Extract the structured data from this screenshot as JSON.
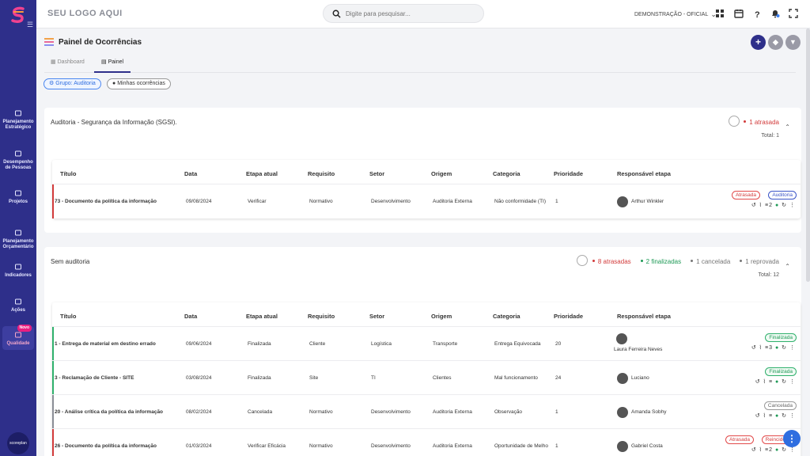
{
  "sidebar": {
    "items": [
      {
        "label": "Planejamento Estratégico",
        "icon": "house-icon"
      },
      {
        "label": "Desempenho de Pessoas",
        "icon": "handshake-icon"
      },
      {
        "label": "Projetos",
        "icon": "briefcase-icon"
      },
      {
        "label": "Planejamento Orçamentário",
        "icon": "bank-icon"
      },
      {
        "label": "Indicadores",
        "icon": "bar-chart-icon"
      },
      {
        "label": "Ações",
        "icon": "list-icon"
      },
      {
        "label": "Qualidade",
        "icon": "trend-icon",
        "badge": "Novo",
        "active": true
      }
    ],
    "bottom_label": "scoreplan"
  },
  "topbar": {
    "logo": "SEU LOGO AQUI",
    "search_placeholder": "Digite para pesquisar...",
    "environment": "DEMONSTRAÇÃO - OFICIAL"
  },
  "page": {
    "title": "Painel de Ocorrências",
    "tabs": [
      {
        "label": "Dashboard"
      },
      {
        "label": "Painel",
        "active": true
      }
    ],
    "chips": {
      "group": "Grupo: Auditoria",
      "mine": "Minhas ocorrências"
    }
  },
  "columns": [
    "Título",
    "Data",
    "Etapa atual",
    "Requisito",
    "Setor",
    "Origem",
    "Categoria",
    "Prioridade",
    "Responsável etapa"
  ],
  "groups": [
    {
      "title": "Auditoria - Segurança da Informação (SGSI).",
      "stats": [
        {
          "label": "1 atrasada",
          "color": "#d23b3b"
        }
      ],
      "total": "Total: 1",
      "rows": [
        {
          "titulo": "73 - Documento da política da informação",
          "data": "09/08/2024",
          "etapa": "Verificar",
          "requisito": "Normativo",
          "setor": "Desenvolvimento",
          "origem": "Auditoria Externa",
          "categoria": "Não conformidade (TI)",
          "prioridade": "1",
          "responsavel": "Arthur Winkler",
          "bar": "#d23b3b",
          "tags": [
            {
              "label": "Atrasada",
              "style": "red"
            },
            {
              "label": "Auditoria",
              "style": "blue"
            }
          ],
          "acts": "2"
        }
      ]
    },
    {
      "title": "Sem auditoria",
      "stats": [
        {
          "label": "8 atrasadas",
          "color": "#d23b3b"
        },
        {
          "label": "2 finalizadas",
          "color": "#1f9a57"
        },
        {
          "label": "1 cancelada",
          "color": "#777777"
        },
        {
          "label": "1 reprovada",
          "color": "#777777"
        }
      ],
      "total": "Total: 12",
      "rows": [
        {
          "titulo": "1 - Entrega de material em destino errado",
          "data": "09/06/2024",
          "etapa": "Finalizada",
          "requisito": "Cliente",
          "setor": "Logística",
          "origem": "Transporte",
          "categoria": "Entrega Equivocada",
          "prioridade": "20",
          "responsavel": "Laura Ferreira Neves",
          "bar": "#2fb06c",
          "tags": [
            {
              "label": "Finalizada",
              "style": "green"
            }
          ],
          "acts": "3"
        },
        {
          "titulo": "3 - Reclamação de Cliente - SITE",
          "data": "03/08/2024",
          "etapa": "Finalizada",
          "requisito": "Site",
          "setor": "TI",
          "origem": "Clientes",
          "categoria": "Mal funcionamento",
          "prioridade": "24",
          "responsavel": "Luciano",
          "bar": "#2fb06c",
          "tags": [
            {
              "label": "Finalizada",
              "style": "green"
            }
          ],
          "acts": ""
        },
        {
          "titulo": "20 - Análise crítica da política da informação",
          "data": "08/02/2024",
          "etapa": "Cancelada",
          "requisito": "Normativo",
          "setor": "Desenvolvimento",
          "origem": "Auditoria Externa",
          "categoria": "Observação",
          "prioridade": "1",
          "responsavel": "Amanda Sobhy",
          "bar": "#8a8d96",
          "tags": [
            {
              "label": "Cancelada",
              "style": "gray"
            }
          ],
          "acts": ""
        },
        {
          "titulo": "26 - Documento da política da informação",
          "data": "01/03/2024",
          "etapa": "Verificar Eficácia",
          "requisito": "Normativo",
          "setor": "Desenvolvimento",
          "origem": "Auditoria Externa",
          "categoria": "Oportunidade de Melho",
          "prioridade": "1",
          "responsavel": "Gabriel Costa",
          "bar": "#d23b3b",
          "tags": [
            {
              "label": "Atrasada",
              "style": "red"
            },
            {
              "label": "Reincidente",
              "style": "red"
            }
          ],
          "acts": "2"
        }
      ]
    }
  ],
  "colors": {
    "sidebar": "#2e2f8a",
    "accent": "#2f6ee0",
    "late": "#d23b3b",
    "done": "#1f9a57"
  }
}
